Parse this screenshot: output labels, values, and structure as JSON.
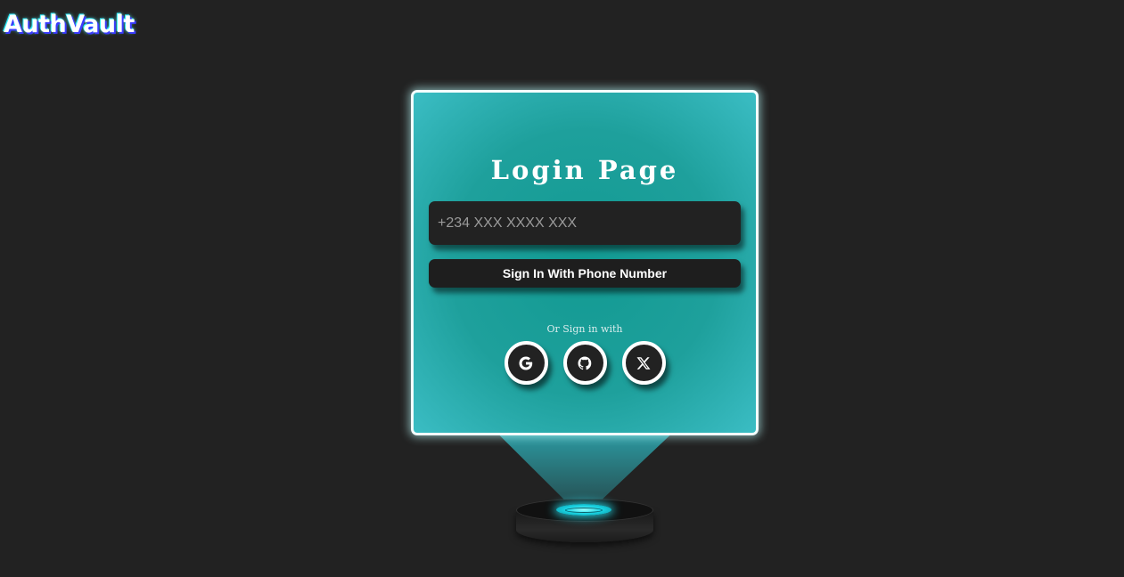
{
  "header": {
    "logo_text": "AuthVault"
  },
  "login": {
    "title": "Login Page",
    "phone_placeholder": "+234 XXX XXXX XXX",
    "phone_value": "",
    "signin_label": "Sign In With Phone Number",
    "or_text": "Or Sign in with"
  },
  "socials": [
    {
      "name": "Google",
      "icon": "google-icon"
    },
    {
      "name": "GitHub",
      "icon": "github-icon"
    },
    {
      "name": "X",
      "icon": "x-icon"
    }
  ],
  "colors": {
    "background": "#222222",
    "card_teal": "#129a92",
    "card_border": "#f4ffff",
    "hologram_light": "#19d6e6"
  }
}
